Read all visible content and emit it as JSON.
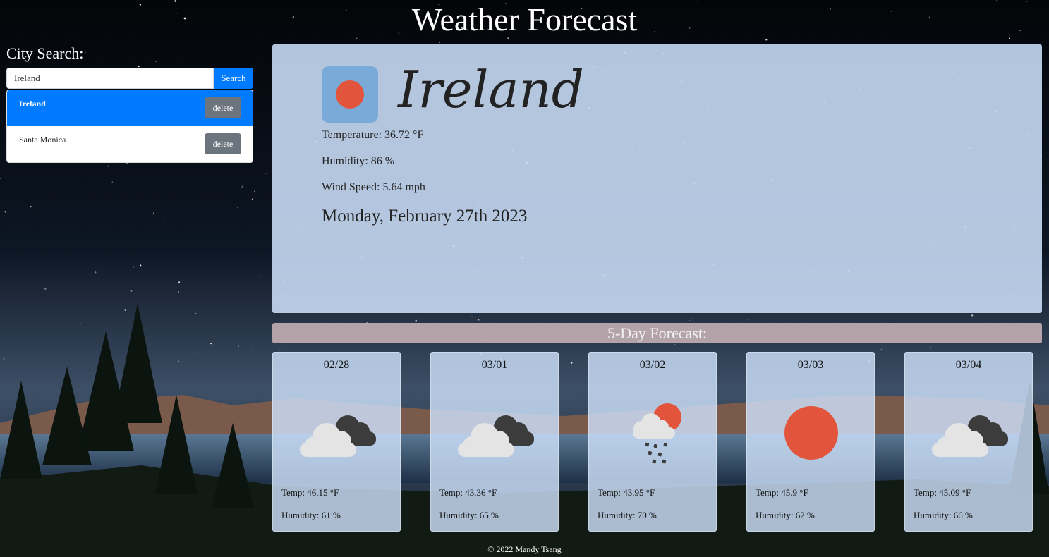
{
  "header": {
    "title": "Weather Forecast"
  },
  "search": {
    "label": "City Search:",
    "value": "Ireland",
    "button_label": "Search"
  },
  "history": [
    {
      "name": "Ireland",
      "delete_label": "delete",
      "active": true
    },
    {
      "name": "Santa Monica",
      "delete_label": "delete",
      "active": false
    }
  ],
  "current": {
    "city": "Ireland",
    "icon": "clear-sun-icon",
    "temperature": "Temperature: 36.72 °F",
    "humidity": "Humidity: 86 %",
    "wind": "Wind Speed: 5.64 mph",
    "date": "Monday, February 27th 2023"
  },
  "forecast": {
    "title": "5-Day Forecast:",
    "days": [
      {
        "date": "02/28",
        "icon": "broken-clouds-icon",
        "temp": "Temp: 46.15 °F",
        "humidity": "Humidity: 61 %"
      },
      {
        "date": "03/01",
        "icon": "broken-clouds-icon",
        "temp": "Temp: 43.36 °F",
        "humidity": "Humidity: 65 %"
      },
      {
        "date": "03/02",
        "icon": "rain-sun-icon",
        "temp": "Temp: 43.95 °F",
        "humidity": "Humidity: 70 %"
      },
      {
        "date": "03/03",
        "icon": "clear-sun-icon",
        "temp": "Temp: 45.9 °F",
        "humidity": "Humidity: 62 %"
      },
      {
        "date": "03/04",
        "icon": "broken-clouds-icon",
        "temp": "Temp: 45.09 °F",
        "humidity": "Humidity: 66 %"
      }
    ]
  },
  "footer": {
    "text": "© 2022 Mandy Tsang"
  },
  "colors": {
    "accent": "#007bff",
    "delete": "#6c757d",
    "sun": "#e2553c",
    "panel": "#c6daf4"
  }
}
